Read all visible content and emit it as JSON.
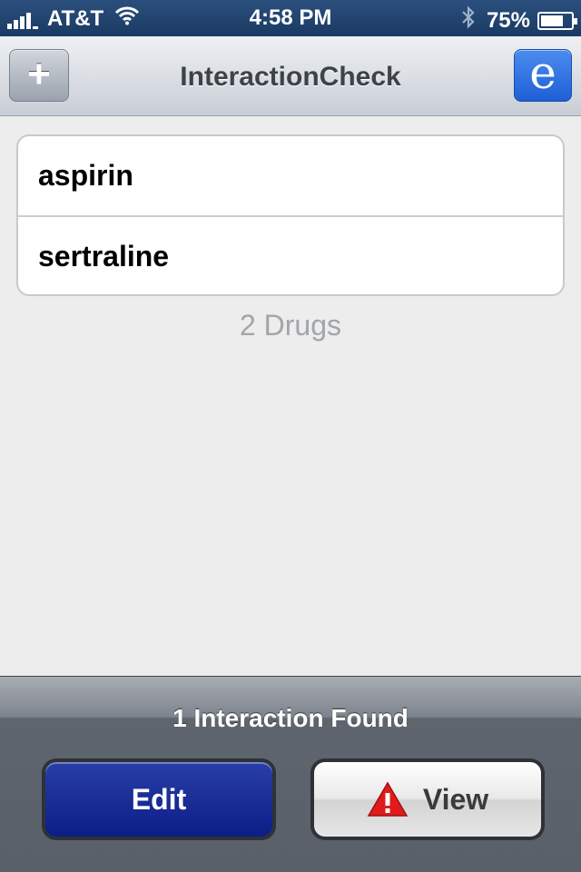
{
  "status_bar": {
    "carrier": "AT&T",
    "time": "4:58 PM",
    "battery_percent": "75%",
    "battery_level": 0.75
  },
  "nav": {
    "title": "InteractionCheck",
    "add_label": "+",
    "right_label": "e"
  },
  "drugs": {
    "items": [
      "aspirin",
      "sertraline"
    ],
    "count_label": "2 Drugs"
  },
  "bottom": {
    "status": "1 Interaction Found",
    "edit_label": "Edit",
    "view_label": "View"
  },
  "colors": {
    "accent": "#1e5fd6",
    "edit_button": "#0b1e86",
    "warning": "#e01b1b"
  },
  "icons": {
    "signal": "signal-bars-icon",
    "wifi": "wifi-icon",
    "bluetooth": "bluetooth-icon",
    "battery": "battery-icon",
    "add": "plus-icon",
    "warning": "warning-triangle-icon"
  }
}
